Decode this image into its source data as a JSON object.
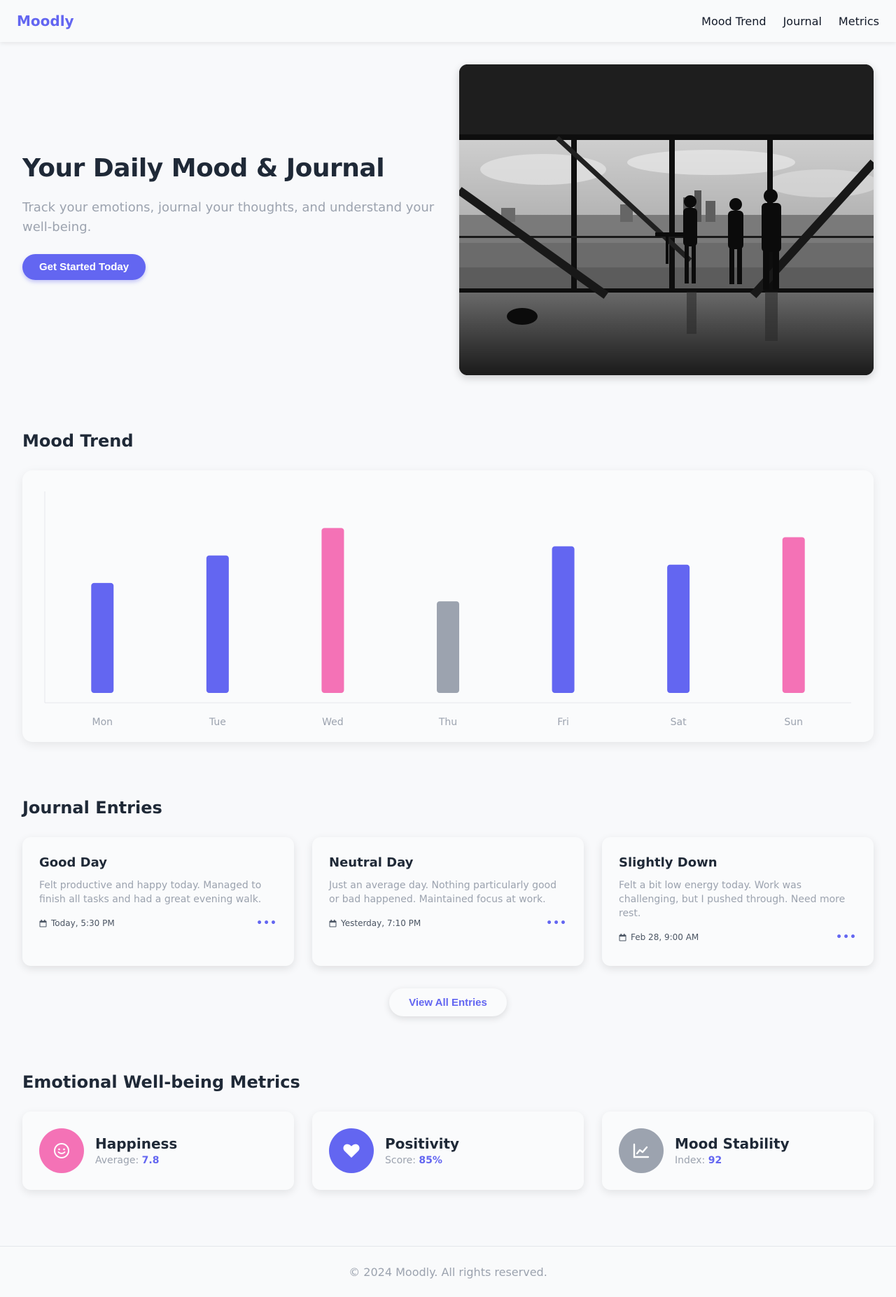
{
  "header": {
    "brand": "Moodly",
    "nav": [
      "Mood Trend",
      "Journal",
      "Metrics"
    ]
  },
  "hero": {
    "title": "Your Daily Mood & Journal",
    "subtitle": "Track your emotions, journal your thoughts, and understand your well-being.",
    "cta_label": "Get Started Today",
    "image_alt": "Silhouettes of people at a large window overlooking a city skyline"
  },
  "mood_trend": {
    "title": "Mood Trend"
  },
  "chart_data": {
    "type": "bar",
    "categories": [
      "Mon",
      "Tue",
      "Wed",
      "Thu",
      "Fri",
      "Sat",
      "Sun"
    ],
    "values": [
      6.0,
      7.5,
      9.0,
      5.0,
      8.0,
      7.0,
      8.5
    ],
    "bar_colors": [
      "#6366f1",
      "#6366f1",
      "#f472b6",
      "#9ca3af",
      "#6366f1",
      "#6366f1",
      "#f472b6"
    ],
    "ylim": [
      0,
      11
    ],
    "grid": false,
    "title": "",
    "xlabel": "",
    "ylabel": ""
  },
  "journal": {
    "title": "Journal Entries",
    "entries": [
      {
        "title": "Good Day",
        "text": "Felt productive and happy today. Managed to finish all tasks and had a great evening walk.",
        "date": "Today, 5:30 PM"
      },
      {
        "title": "Neutral Day",
        "text": "Just an average day. Nothing particularly good or bad happened. Maintained focus at work.",
        "date": "Yesterday, 7:10 PM"
      },
      {
        "title": "Slightly Down",
        "text": "Felt a bit low energy today. Work was challenging, but I pushed through. Need more rest.",
        "date": "Feb 28, 9:00 AM"
      }
    ],
    "view_all_label": "View All Entries"
  },
  "metrics": {
    "title": "Emotional Well-being Metrics",
    "items": [
      {
        "title": "Happiness",
        "label": "Average:",
        "value": "7.8",
        "icon": "smile-icon",
        "color": "#f472b6"
      },
      {
        "title": "Positivity",
        "label": "Score:",
        "value": "85%",
        "icon": "heart-icon",
        "color": "#6366f1"
      },
      {
        "title": "Mood Stability",
        "label": "Index:",
        "value": "92",
        "icon": "chart-line-icon",
        "color": "#9ca3af"
      }
    ]
  },
  "footer": {
    "text": "© 2024 Moodly. All rights reserved."
  },
  "colors": {
    "accent": "#6366f1",
    "pink": "#f472b6",
    "gray": "#9ca3af",
    "background": "#f8f9fb"
  }
}
